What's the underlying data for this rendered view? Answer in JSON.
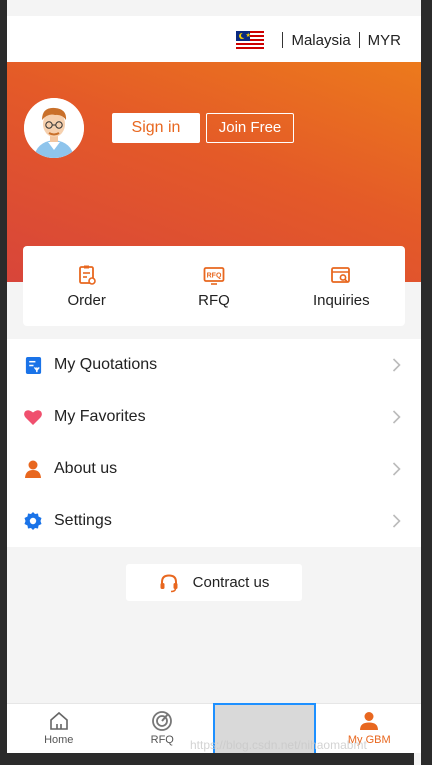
{
  "region": {
    "country": "Malaysia",
    "currency": "MYR",
    "flag_icon": "malaysia-flag-icon"
  },
  "hero": {
    "signin_label": "Sign in",
    "join_label": "Join Free",
    "gradient_start": "#ec7a1c",
    "gradient_end": "#d8453a"
  },
  "quick": [
    {
      "label": "Order",
      "icon": "order-clipboard-icon"
    },
    {
      "label": "RFQ",
      "icon": "rfq-icon"
    },
    {
      "label": "Inquiries",
      "icon": "inquiries-card-icon"
    }
  ],
  "menu": [
    {
      "label": "My Quotations",
      "icon": "quotation-doc-icon",
      "color": "#1a73e8"
    },
    {
      "label": "My Favorites",
      "icon": "heart-icon",
      "color": "#f0506e"
    },
    {
      "label": "About us",
      "icon": "person-icon",
      "color": "#e8671f"
    },
    {
      "label": "Settings",
      "icon": "gear-icon",
      "color": "#1a73e8"
    }
  ],
  "contact": {
    "label": "Contract us",
    "icon": "headset-icon"
  },
  "bottom_nav": [
    {
      "label": "Home",
      "icon": "home-icon",
      "active": false
    },
    {
      "label": "RFQ",
      "icon": "radar-icon",
      "active": false
    },
    {
      "label": "",
      "icon": "",
      "active": false
    },
    {
      "label": "My GBM",
      "icon": "user-icon",
      "active": true
    }
  ],
  "watermark": "https://blog.csdn.net/nihaomabmt",
  "colors": {
    "accent": "#e8671f",
    "blue": "#1a73e8"
  }
}
